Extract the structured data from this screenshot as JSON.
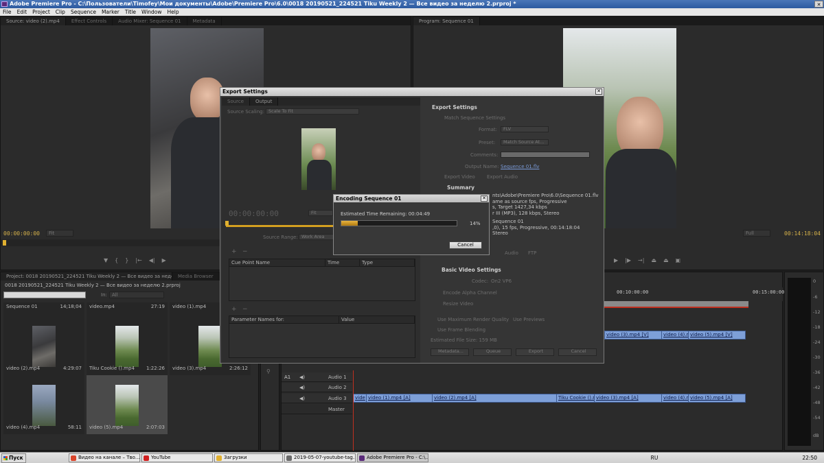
{
  "window": {
    "title": "Adobe Premiere Pro - C:\\Пользователи\\Timofey\\Мои документы\\Adobe\\Premiere Pro\\6.0\\0018 20190521_224521 Tiku Weekly 2 — Все видео за неделю 2.prproj *"
  },
  "menu": [
    "File",
    "Edit",
    "Project",
    "Clip",
    "Sequence",
    "Marker",
    "Title",
    "Window",
    "Help"
  ],
  "source_panel": {
    "tabs": [
      "Source: video (2).mp4",
      "Effect Controls",
      "Audio Mixer: Sequence 01",
      "Metadata"
    ],
    "timecode": "00:00:00:00",
    "fit": "Fit"
  },
  "program_panel": {
    "tab": "Program: Sequence 01",
    "fit": "Full",
    "timecode": "00:14:18:04"
  },
  "project_panel": {
    "tabs": [
      "Project: 0018 20190521_224521 Tiku Weekly 2 — Все видео за неделю 2",
      "Media Browser",
      "I"
    ],
    "path": "0018 20190521_224521 Tiku Weekly 2 — Все видео за неделю 2.prproj",
    "in_label": "In:",
    "in_value": "All",
    "items": [
      {
        "name": "Sequence 01",
        "duration": "14;18;04"
      },
      {
        "name": "video.mp4",
        "duration": "27:19"
      },
      {
        "name": "video (1).mp4",
        "duration": ""
      },
      {
        "name": "video (2).mp4",
        "duration": "4:29:07"
      },
      {
        "name": "Tiku Cookie ().mp4",
        "duration": "1:22:26"
      },
      {
        "name": "video (3).mp4",
        "duration": "2:26:12"
      },
      {
        "name": "video (4).mp4",
        "duration": "58:11"
      },
      {
        "name": "video (5).mp4",
        "duration": "2:07:03"
      }
    ]
  },
  "export": {
    "title": "Export Settings",
    "tabs": [
      "Source",
      "Output"
    ],
    "source_scaling_label": "Source Scaling:",
    "source_scaling_value": "Scale To Fit",
    "timecode": "00:00:00:00",
    "fit": "Fit",
    "source_range_label": "Source Range:",
    "source_range_value": "Work Area",
    "cue_columns": [
      "Cue Point Name",
      "Time",
      "Type"
    ],
    "param_columns": [
      "Parameter Names for:",
      "Value"
    ],
    "settings": {
      "heading": "Export Settings",
      "match_sequence": "Match Sequence Settings",
      "format_label": "Format:",
      "format_value": "FLV",
      "preset_label": "Preset:",
      "preset_value": "Match Source At...",
      "comments_label": "Comments:",
      "output_name_label": "Output Name:",
      "output_name_value": "Sequence 01.flv",
      "export_video": "Export Video",
      "export_audio": "Export Audio",
      "summary_heading": "Summary",
      "summary_lines": [
        "nts\\Adobe\\Premiere Pro\\6.0\\Sequence 01.flv",
        "ame as source fps, Progressive",
        "s, Target 1427,34 kbps",
        "r III (MP3), 128 kbps, Stereo",
        "Sequence 01",
        ",0), 15 fps, Progressive, 00:14:18:04",
        "Stereo"
      ],
      "sub_tabs": [
        "Audio",
        "FTP"
      ],
      "basic_video": "Basic Video Settings",
      "codec_label": "Codec:",
      "codec_value": "On2 VP6",
      "encode_alpha": "Encode Alpha Channel",
      "resize_video": "Resize Video",
      "max_render": "Use Maximum Render Quality",
      "use_previews": "Use Previews",
      "frame_blending": "Use Frame Blending",
      "file_size": "Estimated File Size: 159 MB",
      "buttons": [
        "Metadata...",
        "Queue",
        "Export",
        "Cancel"
      ]
    }
  },
  "encoding": {
    "title": "Encoding Sequence 01",
    "remaining": "Estimated Time Remaining: 00:04:49",
    "progress": 0.14,
    "progress_label": "14%",
    "cancel": "Cancel"
  },
  "timeline": {
    "ruler": [
      "00:10:00:00",
      "00:15:00:00"
    ],
    "a1": "A1",
    "tracks": [
      "Audio 1",
      "Audio 2",
      "Audio 3",
      "Master"
    ],
    "video_clips": [
      "video (3).mp4 [V]",
      "video (4).m",
      "video (5).mp4 [V]"
    ],
    "audio_clips": [
      "vide",
      "video (1).mp4 [A]",
      "video (2).mp4 [A]",
      "Tiku Cookie ().m",
      "video (3).mp4 [A]",
      "video (4).m",
      "video (5).mp4 [A]"
    ]
  },
  "meter_scale": [
    "0",
    "-6",
    "-12",
    "-18",
    "-24",
    "-30",
    "-36",
    "-42",
    "-48",
    "-54",
    "dB"
  ],
  "taskbar": {
    "start": "Пуск",
    "items": [
      {
        "label": "Видео на канале – Тво...",
        "color": "#d8452b"
      },
      {
        "label": "YouTube",
        "color": "#d02020"
      },
      {
        "label": "Загрузки",
        "color": "#e0b030"
      },
      {
        "label": "2019-05-07-youtube-tag...",
        "color": "#6a6a6a"
      },
      {
        "label": "Adobe Premiere Pro - C:\\...",
        "color": "#5a2a7a"
      }
    ],
    "lang": "RU",
    "clock": "22:50"
  }
}
